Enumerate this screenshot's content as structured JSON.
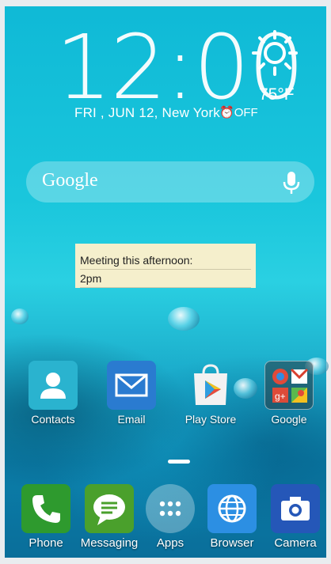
{
  "clock": {
    "time": "12:00",
    "date_location": "FRI , JUN 12, New York",
    "alarm": "OFF",
    "temperature": "75°F",
    "weather_icon": "sun-icon"
  },
  "search": {
    "label": "Google",
    "icon": "mic-icon"
  },
  "memo": {
    "line1": "Meeting this afternoon:",
    "line2": "2pm"
  },
  "home_apps": [
    {
      "label": "Contacts",
      "icon": "contacts-icon"
    },
    {
      "label": "Email",
      "icon": "email-icon"
    },
    {
      "label": "Play Store",
      "icon": "play-store-icon"
    },
    {
      "label": "Google",
      "icon": "google-folder-icon"
    }
  ],
  "dock": [
    {
      "label": "Phone",
      "icon": "phone-icon"
    },
    {
      "label": "Messaging",
      "icon": "messaging-icon"
    },
    {
      "label": "Apps",
      "icon": "apps-icon"
    },
    {
      "label": "Browser",
      "icon": "browser-icon"
    },
    {
      "label": "Camera",
      "icon": "camera-icon"
    }
  ],
  "colors": {
    "contacts": "#2ab3cf",
    "email": "#2a7bd0",
    "phone": "#2e9a2e",
    "messaging": "#4aa02c",
    "browser": "#2c8fe3",
    "camera": "#2557b8",
    "memo": "#f5efcc"
  }
}
